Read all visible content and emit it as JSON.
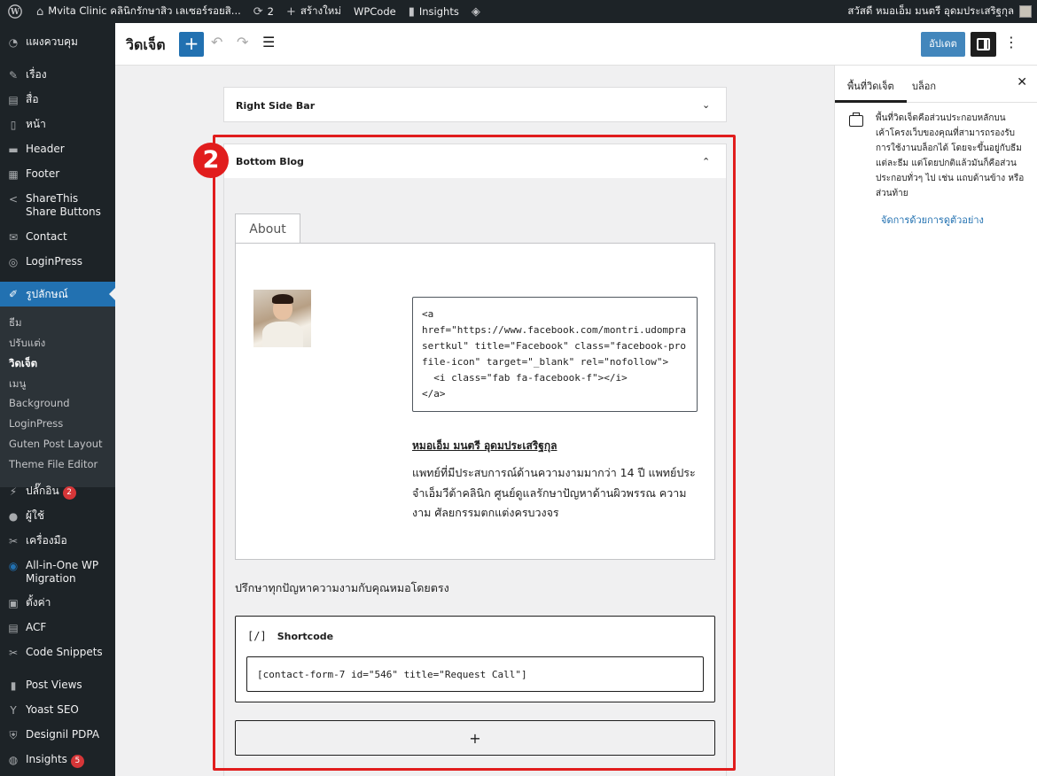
{
  "admin_bar": {
    "site_name": "Mvita Clinic คลินิกรักษาสิว เลเซอร์รอยสิ...",
    "updates_count": "2",
    "new_label": "สร้างใหม่",
    "wpcode_label": "WPCode",
    "insights_label": "Insights",
    "greeting": "สวัสดี หมอเอ็ม มนตรี อุดมประเสริฐกุล"
  },
  "sidebar": {
    "items": [
      {
        "label": "แผงควบคุม",
        "icon": "dashboard-icon"
      },
      {
        "label": "เรื่อง",
        "icon": "pin-icon"
      },
      {
        "label": "สื่อ",
        "icon": "media-icon"
      },
      {
        "label": "หน้า",
        "icon": "page-icon"
      },
      {
        "label": "Header",
        "icon": "header-icon"
      },
      {
        "label": "Footer",
        "icon": "footer-icon"
      },
      {
        "label": "ShareThis Share Buttons",
        "icon": "share-icon"
      },
      {
        "label": "Contact",
        "icon": "mail-icon"
      },
      {
        "label": "LoginPress",
        "icon": "loginpress-icon"
      },
      {
        "label": "รูปลักษณ์",
        "icon": "brush-icon"
      },
      {
        "label": "ปลั๊กอิน",
        "icon": "plugin-icon",
        "badge": "2"
      },
      {
        "label": "ผู้ใช้",
        "icon": "user-icon"
      },
      {
        "label": "เครื่องมือ",
        "icon": "wrench-icon"
      },
      {
        "label": "All-in-One WP Migration",
        "icon": "migration-icon"
      },
      {
        "label": "ตั้งค่า",
        "icon": "settings-icon"
      },
      {
        "label": "ACF",
        "icon": "acf-icon"
      },
      {
        "label": "Code Snippets",
        "icon": "code-icon"
      },
      {
        "label": "Post Views",
        "icon": "chart-icon"
      },
      {
        "label": "Yoast SEO",
        "icon": "yoast-icon"
      },
      {
        "label": "Designil PDPA",
        "icon": "shield-icon"
      },
      {
        "label": "Insights",
        "icon": "insights-icon",
        "badge": "5"
      }
    ],
    "submenu": [
      "ธีม",
      "ปรับแต่ง",
      "วิดเจ็ต",
      "เมนู",
      "Background",
      "LoginPress",
      "Guten Post Layout",
      "Theme File Editor"
    ]
  },
  "editor": {
    "title": "วิดเจ็ต",
    "update_label": "อัปเดต"
  },
  "canvas": {
    "right_side_bar": "Right Side Bar",
    "bottom_blog": "Bottom Blog",
    "step_number": "2",
    "tab_label": "About",
    "code": "<a\nhref=\"https://www.facebook.com/montri.udomprasertkul\" title=\"Facebook\" class=\"facebook-profile-icon\" target=\"_blank\" rel=\"nofollow\">\n  <i class=\"fab fa-facebook-f\"></i>\n</a>",
    "doctor_name": "หมอเอ็ม มนตรี อุดมประเสริฐกุล",
    "bio": "แพทย์ที่มีประสบการณ์ด้านความงามมากว่า 14 ปี แพทย์ประจำเอ็มวีต้าคลินิก ศูนย์ดูแลรักษาปัญหาด้านผิวพรรณ ความงาม ศัลยกรรมตกแต่งครบวงจร",
    "consult_text": "ปรึกษาทุกปัญหาความงามกับคุณหมอโดยตรง",
    "shortcode_bracket": "[/]",
    "shortcode_label": "Shortcode",
    "shortcode_value": "[contact-form-7 id=\"546\" title=\"Request Call\"]",
    "add_block_symbol": "+"
  },
  "settings_panel": {
    "tab_widgets": "พื้นที่วิดเจ็ต",
    "tab_block": "บล็อก",
    "description": "พื้นที่วิดเจ็ตคือส่วนประกอบหลักบนเค้าโครงเว็บของคุณที่สามารถรองรับการใช้งานบล็อกได้ โดยจะขึ้นอยู่กับธีมแต่ละธีม แต่โดยปกติแล้วมันก็คือส่วนประกอบทั่วๆ ไป เช่น แถบด้านข้าง หรือส่วนท้าย",
    "manage_link": "จัดการด้วยการดูตัวอย่าง"
  },
  "colors": {
    "accent": "#2271b1",
    "highlight": "#e11d1d",
    "admin_dark": "#1d2327"
  }
}
